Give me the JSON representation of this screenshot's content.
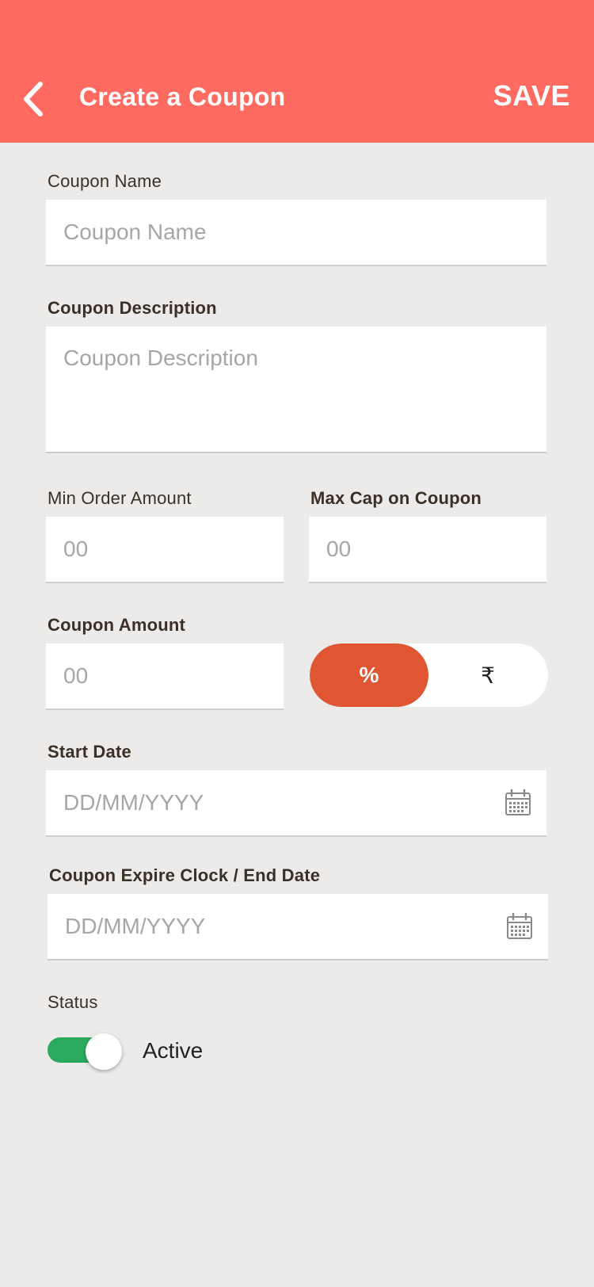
{
  "appbar": {
    "back_icon": "chevron-left-icon",
    "title": "Create a Coupon",
    "save_label": "SAVE",
    "color": "#ff6b61"
  },
  "form": {
    "coupon_name": {
      "label": "Coupon Name",
      "placeholder": "Coupon Name",
      "value": ""
    },
    "coupon_description": {
      "label": "Coupon Description",
      "placeholder": "Coupon Description",
      "value": ""
    },
    "min_order_amount": {
      "label": "Min Order Amount",
      "placeholder": "00",
      "value": ""
    },
    "max_cap": {
      "label": "Max Cap on Coupon",
      "placeholder": "00",
      "value": ""
    },
    "coupon_amount": {
      "label": "Coupon Amount",
      "placeholder": "00",
      "value": ""
    },
    "amount_type": {
      "options": [
        "%",
        "₹"
      ],
      "selected": "%",
      "active_color": "#e05633"
    },
    "start_date": {
      "label": "Start Date",
      "placeholder": "DD/MM/YYYY",
      "icon": "calendar-icon"
    },
    "end_date": {
      "label": "Coupon Expire Clock / End Date",
      "placeholder": "DD/MM/YYYY",
      "icon": "calendar-icon"
    },
    "status": {
      "label": "Status",
      "value": "Active",
      "on": true,
      "on_color": "#2aaa5e"
    }
  }
}
